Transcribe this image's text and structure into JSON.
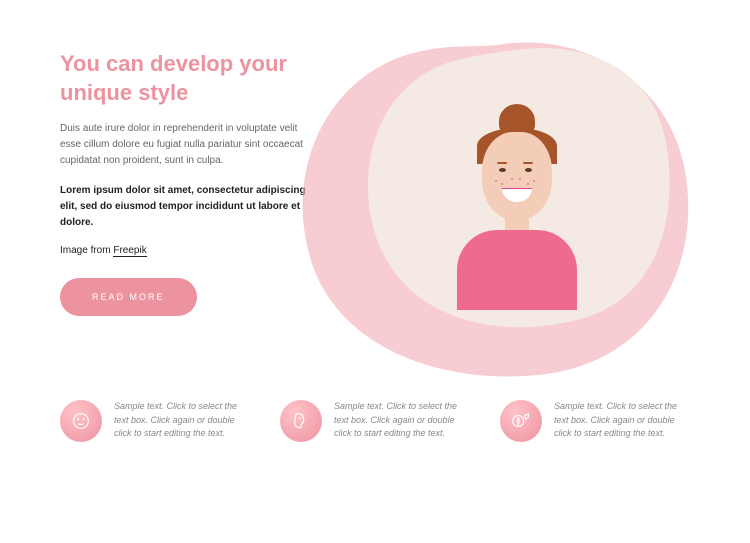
{
  "hero": {
    "title": "You can develop your unique style",
    "paragraph1": "Duis aute irure dolor in reprehenderit in voluptate velit esse cillum dolore eu fugiat nulla pariatur sint occaecat cupidatat non proident, sunt in culpa.",
    "paragraph2": "Lorem ipsum dolor sit amet, consectetur adipiscing elit, sed do eiusmod tempor incididunt ut labore et dolore.",
    "credit_prefix": "Image from ",
    "credit_link": "Freepik",
    "cta_label": "READ MORE"
  },
  "features": [
    {
      "icon": "face-icon",
      "text": "Sample text. Click to select the text box. Click again or double click to start editing the text."
    },
    {
      "icon": "profile-icon",
      "text": "Sample text. Click to select the text box. Click again or double click to start editing the text."
    },
    {
      "icon": "makeup-icon",
      "text": "Sample text. Click to select the text box. Click again or double click to start editing the text."
    }
  ]
}
